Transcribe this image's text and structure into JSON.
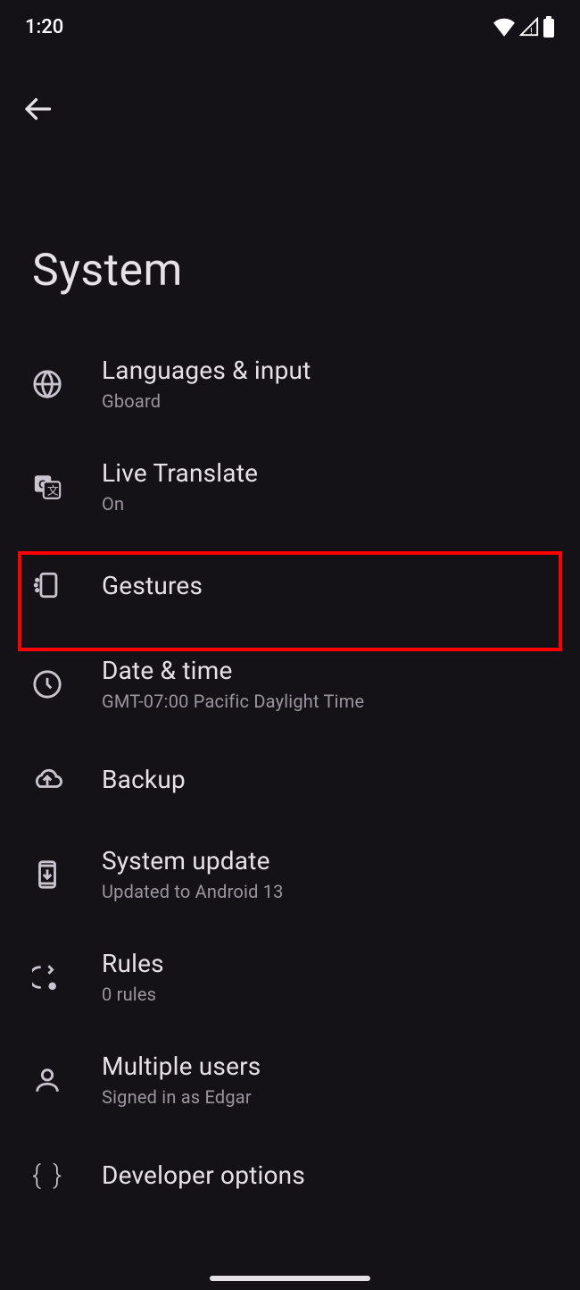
{
  "status": {
    "time": "1:20"
  },
  "header": {
    "title": "System"
  },
  "menu": [
    {
      "title": "Languages & input",
      "sub": "Gboard"
    },
    {
      "title": "Live Translate",
      "sub": "On"
    },
    {
      "title": "Gestures",
      "sub": ""
    },
    {
      "title": "Date & time",
      "sub": "GMT-07:00 Pacific Daylight Time"
    },
    {
      "title": "Backup",
      "sub": ""
    },
    {
      "title": "System update",
      "sub": "Updated to Android 13"
    },
    {
      "title": "Rules",
      "sub": "0 rules"
    },
    {
      "title": "Multiple users",
      "sub": "Signed in as Edgar"
    },
    {
      "title": "Developer options",
      "sub": ""
    }
  ],
  "highlight_index": 2
}
